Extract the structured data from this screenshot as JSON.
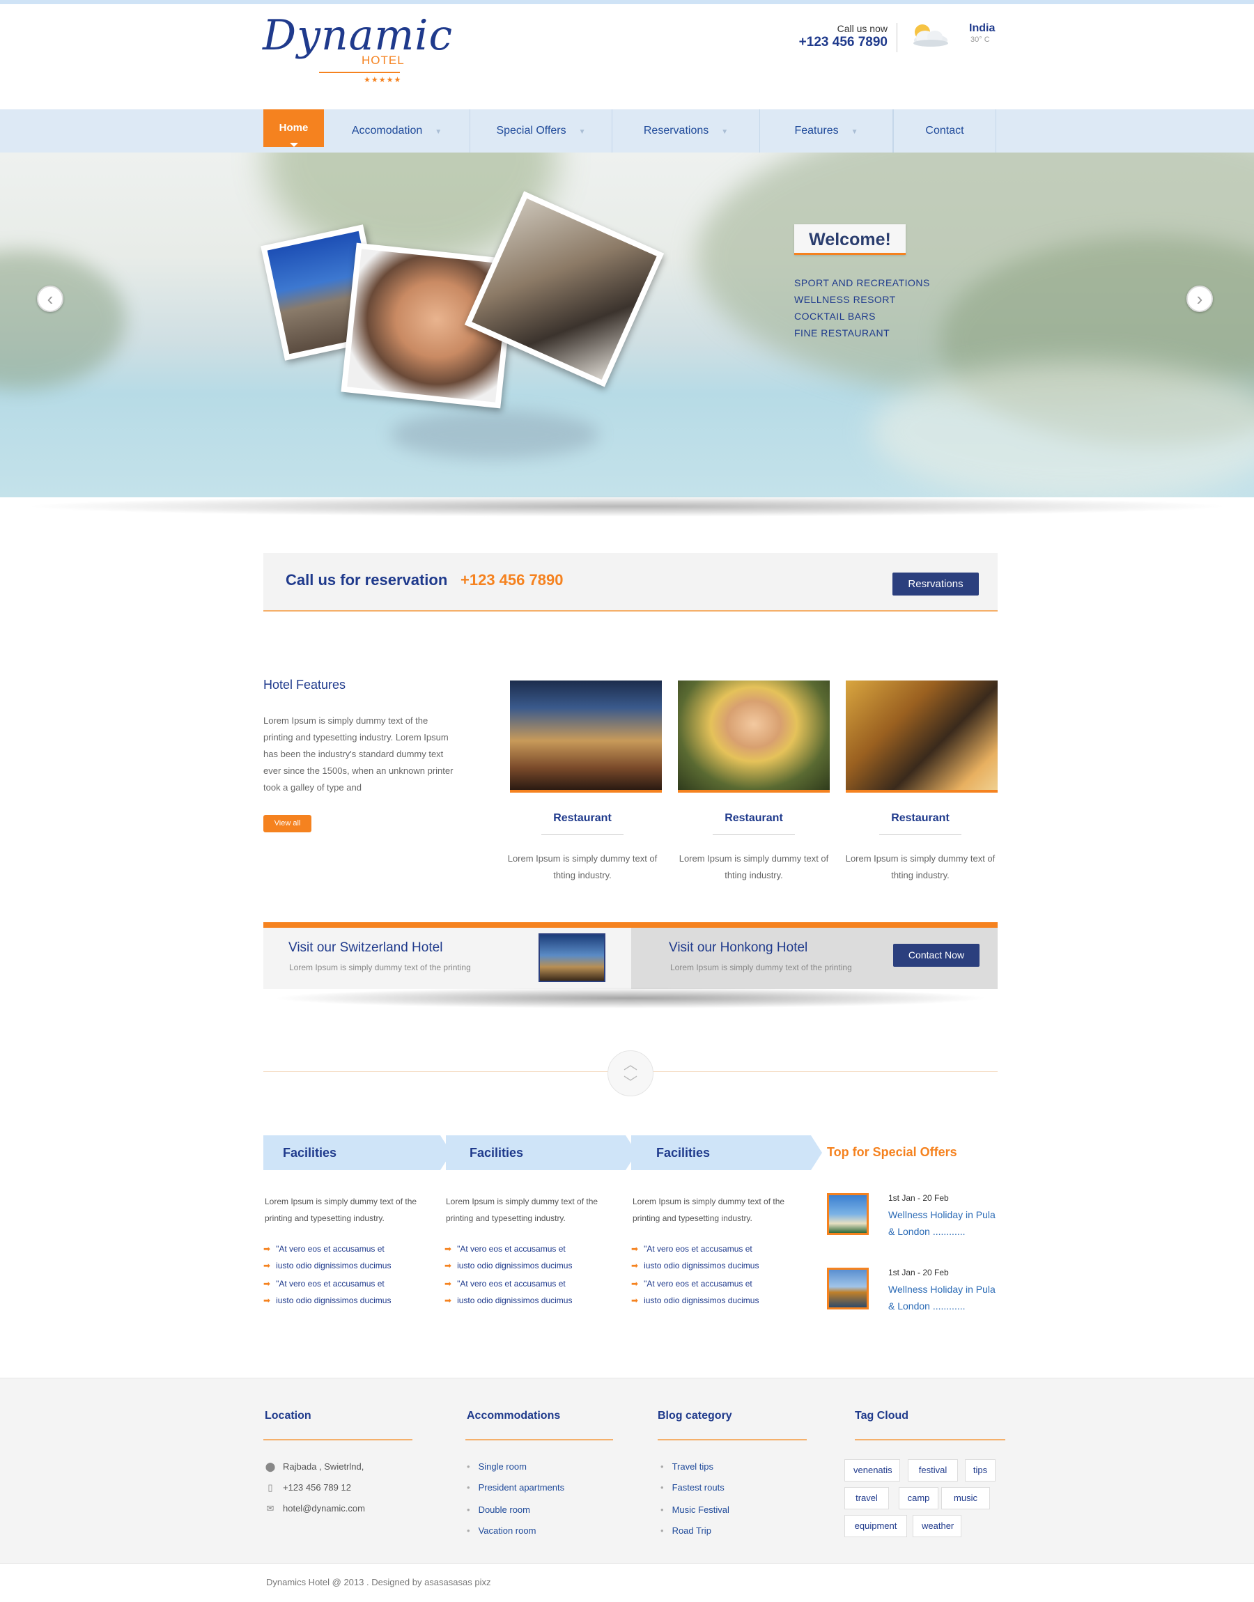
{
  "header": {
    "logo_script": "Dynamic",
    "logo_sub": "HOTEL",
    "logo_stars": "★★★★★",
    "call_label": "Call us now",
    "call_phone": "+123 456 7890",
    "weather_icon": "cloud-sun-icon",
    "city": "India",
    "temperature": "30° C"
  },
  "nav": {
    "items": [
      {
        "label": "Home"
      },
      {
        "label": "Accomodation"
      },
      {
        "label": "Special Offers"
      },
      {
        "label": "Reservations"
      },
      {
        "label": "Features"
      },
      {
        "label": "Contact"
      }
    ],
    "caret": "▼"
  },
  "hero": {
    "prev": "‹",
    "next": "›",
    "welcome": "Welcome!",
    "items": [
      "SPORT AND RECREATIONS",
      "WELLNESS RESORT",
      "COCKTAIL BARS",
      "FINE RESTAURANT"
    ]
  },
  "reservation": {
    "title": "Call us for reservation",
    "phone": "+123 456 7890",
    "button": "Resrvations"
  },
  "features": {
    "title": "Hotel Features",
    "text": "Lorem Ipsum is simply dummy text of the printing and typesetting industry. Lorem Ipsum has been the industry's standard dummy text ever since the 1500s, when an unknown printer took a galley of type and",
    "button": "View all",
    "cards": [
      {
        "title": "Restaurant",
        "text": "Lorem Ipsum is simply dummy text of thting industry."
      },
      {
        "title": "Restaurant",
        "text": "Lorem Ipsum is simply dummy text of thting industry."
      },
      {
        "title": "Restaurant",
        "text": "Lorem Ipsum is simply dummy text of thting industry."
      }
    ]
  },
  "visit": {
    "left_title": "Visit our Switzerland Hotel",
    "left_text": "Lorem Ipsum is simply dummy text of the printing",
    "right_title": "Visit our Honkong Hotel",
    "right_text": "Lorem Ipsum is simply dummy text of the printing",
    "button": "Contact Now"
  },
  "separator": {
    "up": "︿",
    "down": "﹀"
  },
  "facilities": {
    "columns": [
      {
        "title": "Facilities",
        "text": "Lorem Ipsum is simply dummy text of the printing and typesetting industry.",
        "bullets": [
          "\"At vero eos et accusamus et",
          "iusto odio dignissimos ducimus",
          "\"At vero eos et accusamus et",
          "iusto odio dignissimos ducimus"
        ]
      },
      {
        "title": "Facilities",
        "text": "Lorem Ipsum is simply dummy text of the printing and typesetting industry.",
        "bullets": [
          "\"At vero eos et accusamus et",
          "iusto odio dignissimos ducimus",
          "\"At vero eos et accusamus et",
          "iusto odio dignissimos ducimus"
        ]
      },
      {
        "title": "Facilities",
        "text": "Lorem Ipsum is simply dummy text of the printing and typesetting industry.",
        "bullets": [
          "\"At vero eos et accusamus et",
          "iusto odio dignissimos ducimus",
          "\"At vero eos et accusamus et",
          "iusto odio dignissimos ducimus"
        ]
      }
    ],
    "arrow": "➡"
  },
  "offers": {
    "title": "Top for Special Offers",
    "items": [
      {
        "date": "1st Jan - 20 Feb",
        "link": "Wellness Holiday in Pula & London ............"
      },
      {
        "date": "1st Jan - 20 Feb",
        "link": "Wellness Holiday in Pula & London ............"
      }
    ]
  },
  "footer": {
    "location": {
      "title": "Location",
      "address": "Rajbada , Swietrlnd,",
      "phone": "+123 456 789 12",
      "email": "hotel@dynamic.com",
      "icons": [
        "map-pin-icon",
        "phone-icon",
        "mail-icon"
      ]
    },
    "accommodations": {
      "title": "Accommodations",
      "items": [
        "Single room",
        "President apartments",
        "Double room",
        "Vacation room"
      ]
    },
    "blog": {
      "title": "Blog category",
      "items": [
        "Travel tips",
        "Fastest routs",
        "Music Festival",
        "Road Trip"
      ]
    },
    "tags": {
      "title": "Tag Cloud",
      "items": [
        "venenatis",
        "festival",
        "tips",
        "travel",
        "camp",
        "music",
        "equipment",
        "weather"
      ]
    },
    "copyright": "Dynamics Hotel @ 2013 . Designed by asasasasas pixz"
  },
  "colors": {
    "brand_blue": "#1f3a8c",
    "accent_orange": "#f5821f",
    "nav_bg": "#dde9f5",
    "button_navy": "#2b3f7e"
  }
}
